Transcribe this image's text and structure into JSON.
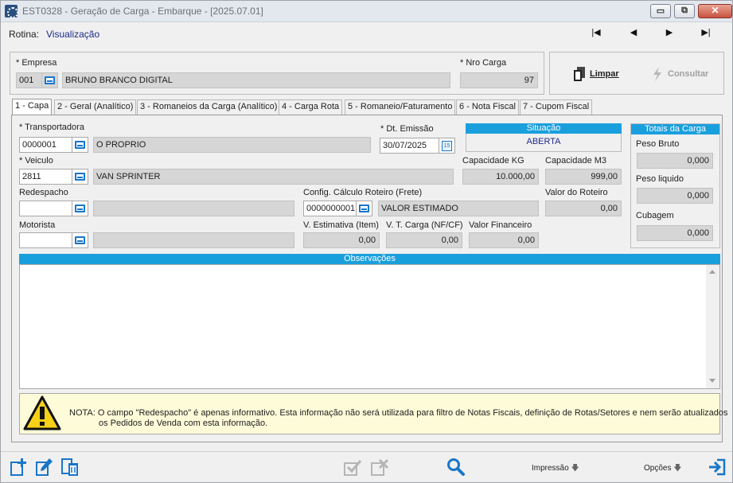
{
  "window": {
    "title": "EST0328 - Geração de Carga - Embarque - [2025.07.01]",
    "min_label": "▭",
    "restore_label": "⧉",
    "close_label": "✕"
  },
  "rotina": {
    "label": "Rotina:",
    "value": "Visualização"
  },
  "nav": {
    "first": "|◀",
    "prev": "◀",
    "next": "▶",
    "last": "▶|"
  },
  "header": {
    "empresa_label": "* Empresa",
    "empresa_code": "001",
    "empresa_name": "BRUNO BRANCO DIGITAL",
    "nro_carga_label": "* Nro Carga",
    "nro_carga_value": "97",
    "limpar_label": "Limpar",
    "consultar_label": "Consultar"
  },
  "tabs": [
    {
      "label": "1 - Capa",
      "active": true
    },
    {
      "label": "2 - Geral (Analítico)",
      "active": false
    },
    {
      "label": "3 - Romaneios da Carga (Analítico)",
      "active": false
    },
    {
      "label": "4 - Carga Rota",
      "active": false
    },
    {
      "label": "5 - Romaneio/Faturamento",
      "active": false
    },
    {
      "label": "6 - Nota Fiscal",
      "active": false
    },
    {
      "label": "7 - Cupom Fiscal",
      "active": false
    }
  ],
  "capa": {
    "transportadora_label": "* Transportadora",
    "transportadora_code": "0000001",
    "transportadora_name": "O PROPRIO",
    "dt_emissao_label": "* Dt. Emissão",
    "dt_emissao_value": "30/07/2025",
    "calendar_day": "15",
    "situacao_label": "Situação",
    "situacao_value": "ABERTA",
    "veiculo_label": "* Veiculo",
    "veiculo_code": "2811",
    "veiculo_name": "VAN SPRINTER",
    "capacidade_kg_label": "Capacidade KG",
    "capacidade_kg_value": "10.000,00",
    "capacidade_m3_label": "Capacidade M3",
    "capacidade_m3_value": "999,00",
    "redespacho_label": "Redespacho",
    "redespacho_code": "",
    "redespacho_name": "",
    "config_label": "Config. Cálculo Roteiro (Frete)",
    "config_code": "0000000001",
    "config_name": "VALOR ESTIMADO",
    "valor_roteiro_label": "Valor do Roteiro",
    "valor_roteiro_value": "0,00",
    "motorista_label": "Motorista",
    "motorista_code": "",
    "motorista_name": "",
    "v_estimativa_label": "V. Estimativa (Item)",
    "v_estimativa_value": "0,00",
    "v_t_carga_label": "V. T. Carga (NF/CF)",
    "v_t_carga_value": "0,00",
    "valor_financeiro_label": "Valor Financeiro",
    "valor_financeiro_value": "0,00",
    "observacoes_label": "Observações",
    "observacoes_value": ""
  },
  "totais": {
    "title": "Totais da Carga",
    "peso_bruto_label": "Peso Bruto",
    "peso_bruto_value": "0,000",
    "peso_liquido_label": "Peso liquido",
    "peso_liquido_value": "0,000",
    "cubagem_label": "Cubagem",
    "cubagem_value": "0,000"
  },
  "nota": {
    "line1": "NOTA:  O campo \"Redespacho\" é apenas informativo. Esta informação não será utilizada para filtro de Notas Fiscais, definição de Rotas/Setores e nem serão atualizados",
    "line2": "os Pedidos de Venda com esta informação."
  },
  "toolbar": {
    "impressao_label": "Impressão",
    "opcoes_label": "Opções"
  },
  "colors": {
    "accent": "#1a9fdd",
    "icon_blue": "#1976c9",
    "readonly_bg": "#d6d6d6",
    "warning_bg": "#fdfbd8"
  }
}
